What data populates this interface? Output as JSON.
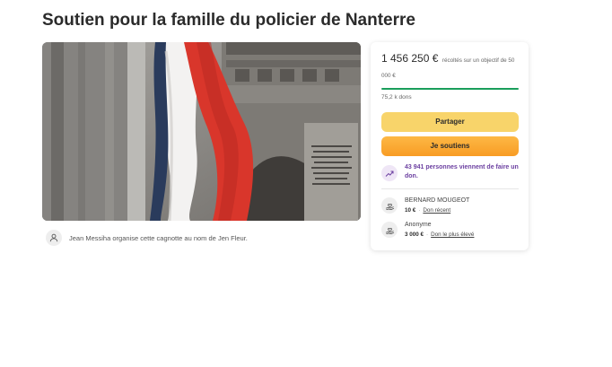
{
  "page": {
    "title": "Soutien pour la famille du policier de Nanterre"
  },
  "hero": {
    "image_description_icon": "arc-de-triomphe-flag-photo"
  },
  "organizer": {
    "icon": "user-icon",
    "text": "Jean Messiha organise cette cagnotte au nom de Jen Fleur."
  },
  "fundraiser": {
    "amount_raised": "1 456 250 €",
    "goal_text": "récoltés sur un objectif de 50 000 €",
    "progress_percent": 100,
    "progress_color": "#1a9e5b",
    "donations_count": "75,2 k dons",
    "share_label": "Partager",
    "donate_label": "Je soutiens",
    "share_color": "#f8d46a",
    "donate_color": "#f89c24",
    "recent_activity": "43 941 personnes viennent de faire un don.",
    "recent_icon": "trending-up-icon",
    "accent_color": "#6b3fa0"
  },
  "donors": [
    {
      "name": "BERNARD MOUGEOT",
      "amount": "10 €",
      "tag": "Don récent",
      "icon": "hand-heart-icon"
    },
    {
      "name": "Anonyme",
      "amount": "3 000 €",
      "tag": "Don le plus élevé",
      "icon": "hand-heart-icon"
    }
  ]
}
